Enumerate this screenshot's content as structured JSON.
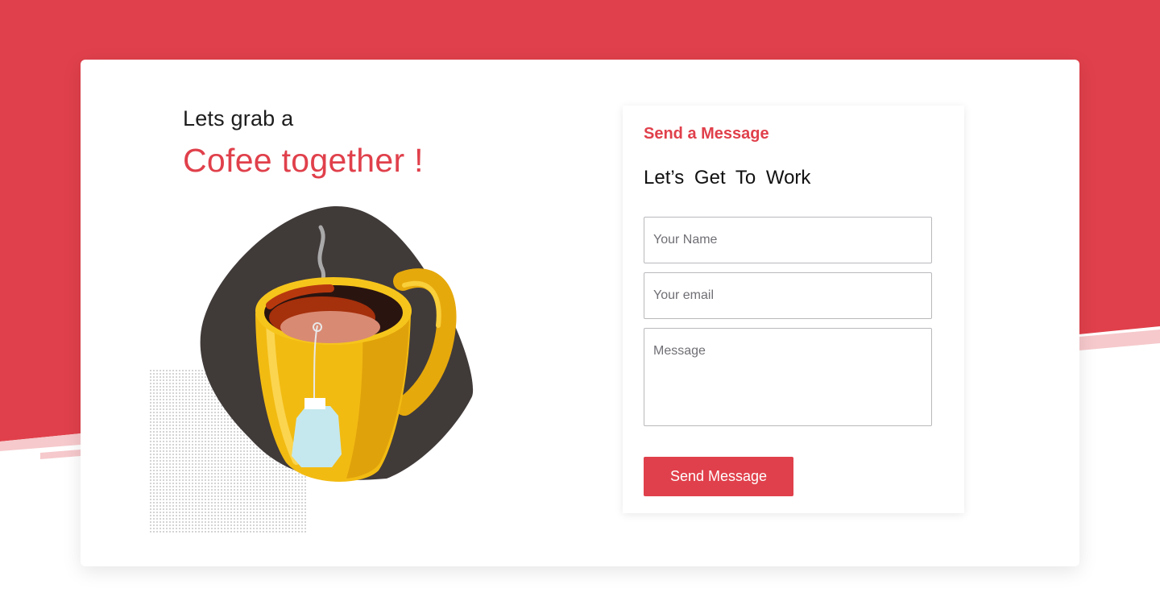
{
  "colors": {
    "accent": "#e0404b",
    "accent_light": "#f6c9cc",
    "mug_yellow": "#f2bb12",
    "blob_dark": "#403a39",
    "tea_bag": "#c5e8ee"
  },
  "hero": {
    "intro": "Lets grab a",
    "title": "Cofee together !",
    "illustration": "coffee-mug-icon"
  },
  "form": {
    "eyebrow": "Send a Message",
    "title": "Let’s Get To Work",
    "name_placeholder": "Your Name",
    "email_placeholder": "Your email",
    "message_placeholder": "Message",
    "submit_label": "Send Message"
  }
}
